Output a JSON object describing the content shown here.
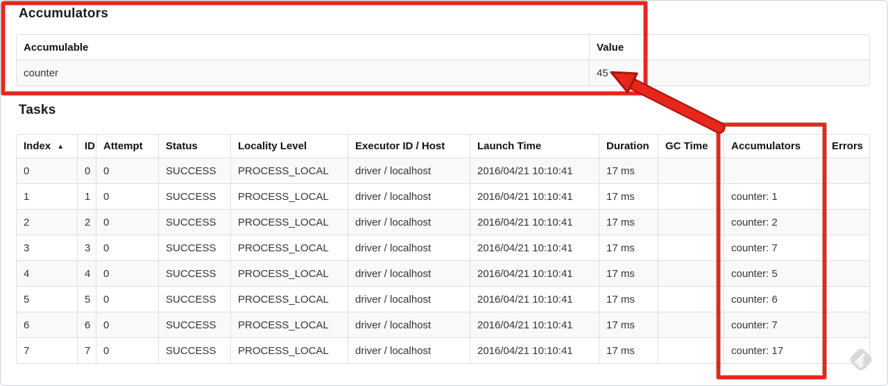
{
  "accumulators_section": {
    "title": "Accumulators",
    "table": {
      "headers": [
        "Accumulable",
        "Value"
      ],
      "rows": [
        [
          "counter",
          "45"
        ]
      ]
    }
  },
  "tasks_section": {
    "title": "Tasks",
    "table": {
      "headers": [
        "Index",
        "ID",
        "Attempt",
        "Status",
        "Locality Level",
        "Executor ID / Host",
        "Launch Time",
        "Duration",
        "GC Time",
        "Accumulators",
        "Errors"
      ],
      "sort_indicator": "▲",
      "sorted_column": "Index",
      "rows": [
        [
          "0",
          "0",
          "0",
          "SUCCESS",
          "PROCESS_LOCAL",
          "driver / localhost",
          "2016/04/21 10:10:41",
          "17 ms",
          "",
          "",
          ""
        ],
        [
          "1",
          "1",
          "0",
          "SUCCESS",
          "PROCESS_LOCAL",
          "driver / localhost",
          "2016/04/21 10:10:41",
          "17 ms",
          "",
          "counter: 1",
          ""
        ],
        [
          "2",
          "2",
          "0",
          "SUCCESS",
          "PROCESS_LOCAL",
          "driver / localhost",
          "2016/04/21 10:10:41",
          "17 ms",
          "",
          "counter: 2",
          ""
        ],
        [
          "3",
          "3",
          "0",
          "SUCCESS",
          "PROCESS_LOCAL",
          "driver / localhost",
          "2016/04/21 10:10:41",
          "17 ms",
          "",
          "counter: 7",
          ""
        ],
        [
          "4",
          "4",
          "0",
          "SUCCESS",
          "PROCESS_LOCAL",
          "driver / localhost",
          "2016/04/21 10:10:41",
          "17 ms",
          "",
          "counter: 5",
          ""
        ],
        [
          "5",
          "5",
          "0",
          "SUCCESS",
          "PROCESS_LOCAL",
          "driver / localhost",
          "2016/04/21 10:10:41",
          "17 ms",
          "",
          "counter: 6",
          ""
        ],
        [
          "6",
          "6",
          "0",
          "SUCCESS",
          "PROCESS_LOCAL",
          "driver / localhost",
          "2016/04/21 10:10:41",
          "17 ms",
          "",
          "counter: 7",
          ""
        ],
        [
          "7",
          "7",
          "0",
          "SUCCESS",
          "PROCESS_LOCAL",
          "driver / localhost",
          "2016/04/21 10:10:41",
          "17 ms",
          "",
          "counter: 17",
          ""
        ]
      ]
    }
  },
  "annotations": {
    "highlight_color": "#e8261b",
    "arrow_outline_color": "#a8130a",
    "arrow_points_to": "45"
  },
  "watermark": {
    "icon": "feedly-logo",
    "color": "#d7d7d7"
  }
}
